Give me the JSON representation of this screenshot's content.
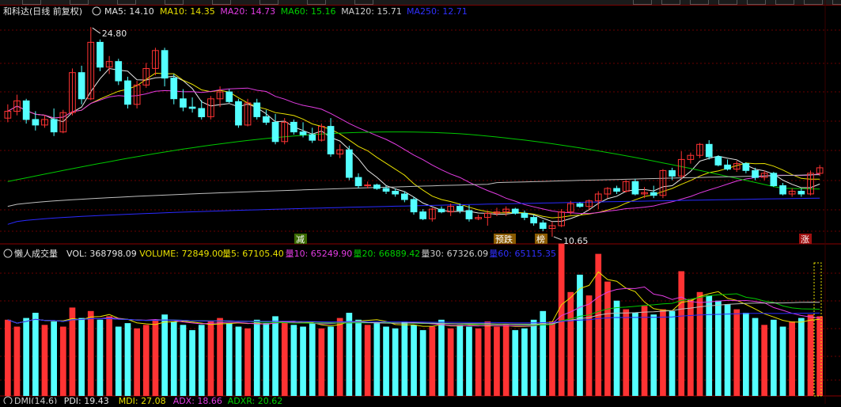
{
  "top_tabs": [
    "",
    "",
    "",
    "",
    "",
    "",
    "",
    "",
    "",
    "",
    "",
    "",
    "",
    "",
    "",
    ""
  ],
  "price_panel": {
    "stock_name": "和科达(日线 前复权)",
    "ma_labels": [
      {
        "text": "MA5: 14.10",
        "color": "#e6e6e6"
      },
      {
        "text": "MA10: 14.35",
        "color": "#e8e000"
      },
      {
        "text": "MA20: 14.73",
        "color": "#e23ce2"
      },
      {
        "text": "MA60: 15.16",
        "color": "#00d000"
      },
      {
        "text": "MA120: 15.71",
        "color": "#cfcfcf"
      },
      {
        "text": "MA250: 12.71",
        "color": "#3030ff"
      }
    ],
    "max_label": "24.80",
    "min_label": "10.65",
    "markers": [
      {
        "text": "减",
        "bg": "#3a6a00",
        "fg": "#ffffff"
      },
      {
        "text": "预跌",
        "bg": "#8a5a00",
        "fg": "#ffffff"
      },
      {
        "text": "榜",
        "bg": "#8a5a00",
        "fg": "#ffffff"
      },
      {
        "text": "涨",
        "bg": "#a01010",
        "fg": "#ffffff"
      }
    ]
  },
  "volume_panel": {
    "title": "懒人成交量",
    "labels": [
      {
        "text": "VOL: 368798.09",
        "color": "#e6e6e6"
      },
      {
        "text": "VOLUME: 72849.00",
        "color": "#e8e000"
      },
      {
        "text": "量5: 67105.40",
        "color": "#e8e000"
      },
      {
        "text": "量10: 65249.90",
        "color": "#e23ce2"
      },
      {
        "text": "量20: 66889.42",
        "color": "#00d000"
      },
      {
        "text": "量30: 67326.09",
        "color": "#cfcfcf"
      },
      {
        "text": "量60: 65115.35",
        "color": "#3030ff"
      }
    ]
  },
  "dmi_panel": {
    "labels": [
      {
        "text": "DMI(14,6)",
        "color": "#cfcfcf"
      },
      {
        "text": "PDI: 19.43",
        "color": "#e6e6e6"
      },
      {
        "text": "MDI: 27.08",
        "color": "#e8e000"
      },
      {
        "text": "ADX: 18.66",
        "color": "#e23ce2"
      },
      {
        "text": "ADXR: 20.62",
        "color": "#00d000"
      }
    ]
  },
  "colors": {
    "up": "#ff3333",
    "down": "#54ffff",
    "grid": "#6a0000",
    "bg": "#000000"
  },
  "chart_data": {
    "type": "candlestick",
    "y_price_range": [
      10.0,
      25.5
    ],
    "candles": [
      [
        18.2,
        19.2,
        17.9,
        18.7
      ],
      [
        18.7,
        19.9,
        18.4,
        19.45
      ],
      [
        19.45,
        19.6,
        17.8,
        18.1
      ],
      [
        18.1,
        18.7,
        17.3,
        17.7
      ],
      [
        17.7,
        18.4,
        17.5,
        18.1
      ],
      [
        18.1,
        18.9,
        16.9,
        17.2
      ],
      [
        17.2,
        18.8,
        17.1,
        18.6
      ],
      [
        18.6,
        21.8,
        18.4,
        21.5
      ],
      [
        21.5,
        22.0,
        19.2,
        19.6
      ],
      [
        19.6,
        24.8,
        19.5,
        23.7
      ],
      [
        23.7,
        23.9,
        21.6,
        21.9
      ],
      [
        21.9,
        22.7,
        21.4,
        22.3
      ],
      [
        22.3,
        22.5,
        20.6,
        20.9
      ],
      [
        20.9,
        21.2,
        18.9,
        19.2
      ],
      [
        19.2,
        20.9,
        18.9,
        20.6
      ],
      [
        20.6,
        22.2,
        20.4,
        21.8
      ],
      [
        21.8,
        23.3,
        21.3,
        23.1
      ],
      [
        23.1,
        23.3,
        20.5,
        21.1
      ],
      [
        21.1,
        21.4,
        19.2,
        19.6
      ],
      [
        19.6,
        20.3,
        18.7,
        19.0
      ],
      [
        19.0,
        19.7,
        18.6,
        18.9
      ],
      [
        18.9,
        19.5,
        18.1,
        18.3
      ],
      [
        18.3,
        19.8,
        18.1,
        19.6
      ],
      [
        19.6,
        20.5,
        19.0,
        20.1
      ],
      [
        20.1,
        20.3,
        19.3,
        19.4
      ],
      [
        19.4,
        19.6,
        17.5,
        17.7
      ],
      [
        17.7,
        19.6,
        17.6,
        19.3
      ],
      [
        19.3,
        19.6,
        18.1,
        18.3
      ],
      [
        18.3,
        18.8,
        17.7,
        17.9
      ],
      [
        17.9,
        18.5,
        16.3,
        16.5
      ],
      [
        16.5,
        18.2,
        16.3,
        17.9
      ],
      [
        17.9,
        18.1,
        17.0,
        17.2
      ],
      [
        17.2,
        17.9,
        16.8,
        17.0
      ],
      [
        17.0,
        17.5,
        16.4,
        16.6
      ],
      [
        16.6,
        17.8,
        16.5,
        17.6
      ],
      [
        17.6,
        18.2,
        15.4,
        15.6
      ],
      [
        15.6,
        16.3,
        15.3,
        15.9
      ],
      [
        15.9,
        16.2,
        13.7,
        13.9
      ],
      [
        13.9,
        14.2,
        13.1,
        13.3
      ],
      [
        13.3,
        13.6,
        13.1,
        13.35
      ],
      [
        13.35,
        13.45,
        13.0,
        13.1
      ],
      [
        13.1,
        13.3,
        12.7,
        12.9
      ],
      [
        12.9,
        13.1,
        12.5,
        12.7
      ],
      [
        12.7,
        12.9,
        12.1,
        12.3
      ],
      [
        12.3,
        12.5,
        11.2,
        11.4
      ],
      [
        11.4,
        11.6,
        10.8,
        10.9
      ],
      [
        10.9,
        11.7,
        10.7,
        11.6
      ],
      [
        11.6,
        11.8,
        11.3,
        11.4
      ],
      [
        11.4,
        12.0,
        11.1,
        11.8
      ],
      [
        11.8,
        12.0,
        11.3,
        11.5
      ],
      [
        11.5,
        11.9,
        10.7,
        10.9
      ],
      [
        10.9,
        11.2,
        10.8,
        11.0
      ],
      [
        11.0,
        11.5,
        10.4,
        11.3
      ],
      [
        11.3,
        11.7,
        11.1,
        11.4
      ],
      [
        11.4,
        11.8,
        11.1,
        11.6
      ],
      [
        11.6,
        11.7,
        11.2,
        11.3
      ],
      [
        11.3,
        11.5,
        10.8,
        11.0
      ],
      [
        11.0,
        11.2,
        10.4,
        10.6
      ],
      [
        10.6,
        10.8,
        10.0,
        10.2
      ],
      [
        10.2,
        10.7,
        9.6,
        10.4
      ],
      [
        10.4,
        11.6,
        10.3,
        11.4
      ],
      [
        11.4,
        12.2,
        11.2,
        12.0
      ],
      [
        12.0,
        12.1,
        11.7,
        11.8
      ],
      [
        11.8,
        12.3,
        11.5,
        12.2
      ],
      [
        12.2,
        12.9,
        11.6,
        12.7
      ],
      [
        12.7,
        13.2,
        12.4,
        13.1
      ],
      [
        13.1,
        13.3,
        12.7,
        12.9
      ],
      [
        12.9,
        13.7,
        12.8,
        13.6
      ],
      [
        13.6,
        13.8,
        12.6,
        12.7
      ],
      [
        12.7,
        13.2,
        12.4,
        12.8
      ],
      [
        12.8,
        13.3,
        12.4,
        12.6
      ],
      [
        12.6,
        14.5,
        12.4,
        14.4
      ],
      [
        14.4,
        14.6,
        13.7,
        14.0
      ],
      [
        14.0,
        15.8,
        13.8,
        15.2
      ],
      [
        15.2,
        15.7,
        14.9,
        15.5
      ],
      [
        15.5,
        16.4,
        15.3,
        16.3
      ],
      [
        16.3,
        16.6,
        15.2,
        15.4
      ],
      [
        15.4,
        15.5,
        14.7,
        14.8
      ],
      [
        14.8,
        15.2,
        14.4,
        14.5
      ],
      [
        14.5,
        15.1,
        14.3,
        14.9
      ],
      [
        14.9,
        15.0,
        14.2,
        14.4
      ],
      [
        14.4,
        14.6,
        13.7,
        13.9
      ],
      [
        13.9,
        14.4,
        13.7,
        14.2
      ],
      [
        14.2,
        14.3,
        13.2,
        13.3
      ],
      [
        13.3,
        13.5,
        12.6,
        12.7
      ],
      [
        12.7,
        13.1,
        12.5,
        12.9
      ],
      [
        12.9,
        13.1,
        12.5,
        12.7
      ],
      [
        12.7,
        14.4,
        12.6,
        14.2
      ],
      [
        14.2,
        14.8,
        14.0,
        14.6
      ]
    ],
    "volume": [
      44000,
      40000,
      45000,
      48000,
      41000,
      43000,
      40000,
      51000,
      45000,
      49000,
      44000,
      46000,
      40000,
      42000,
      39000,
      41000,
      44000,
      47000,
      43000,
      41000,
      38000,
      41000,
      43000,
      45000,
      42000,
      40000,
      39000,
      44000,
      42000,
      46000,
      43000,
      41000,
      40000,
      42000,
      39000,
      40000,
      45000,
      48000,
      44000,
      41000,
      42000,
      40000,
      39000,
      43000,
      41000,
      38000,
      40000,
      44000,
      39000,
      41000,
      40000,
      39000,
      43000,
      40000,
      41000,
      38000,
      39000,
      44000,
      49000,
      43000,
      88000,
      60000,
      70000,
      58000,
      82000,
      66000,
      55000,
      50000,
      48000,
      52000,
      47000,
      50000,
      49000,
      72000,
      56000,
      60000,
      58000,
      55000,
      53000,
      50000,
      48000,
      45000,
      41000,
      44000,
      40000,
      43000,
      45000,
      47000,
      46000
    ],
    "volume_max": 80000
  }
}
